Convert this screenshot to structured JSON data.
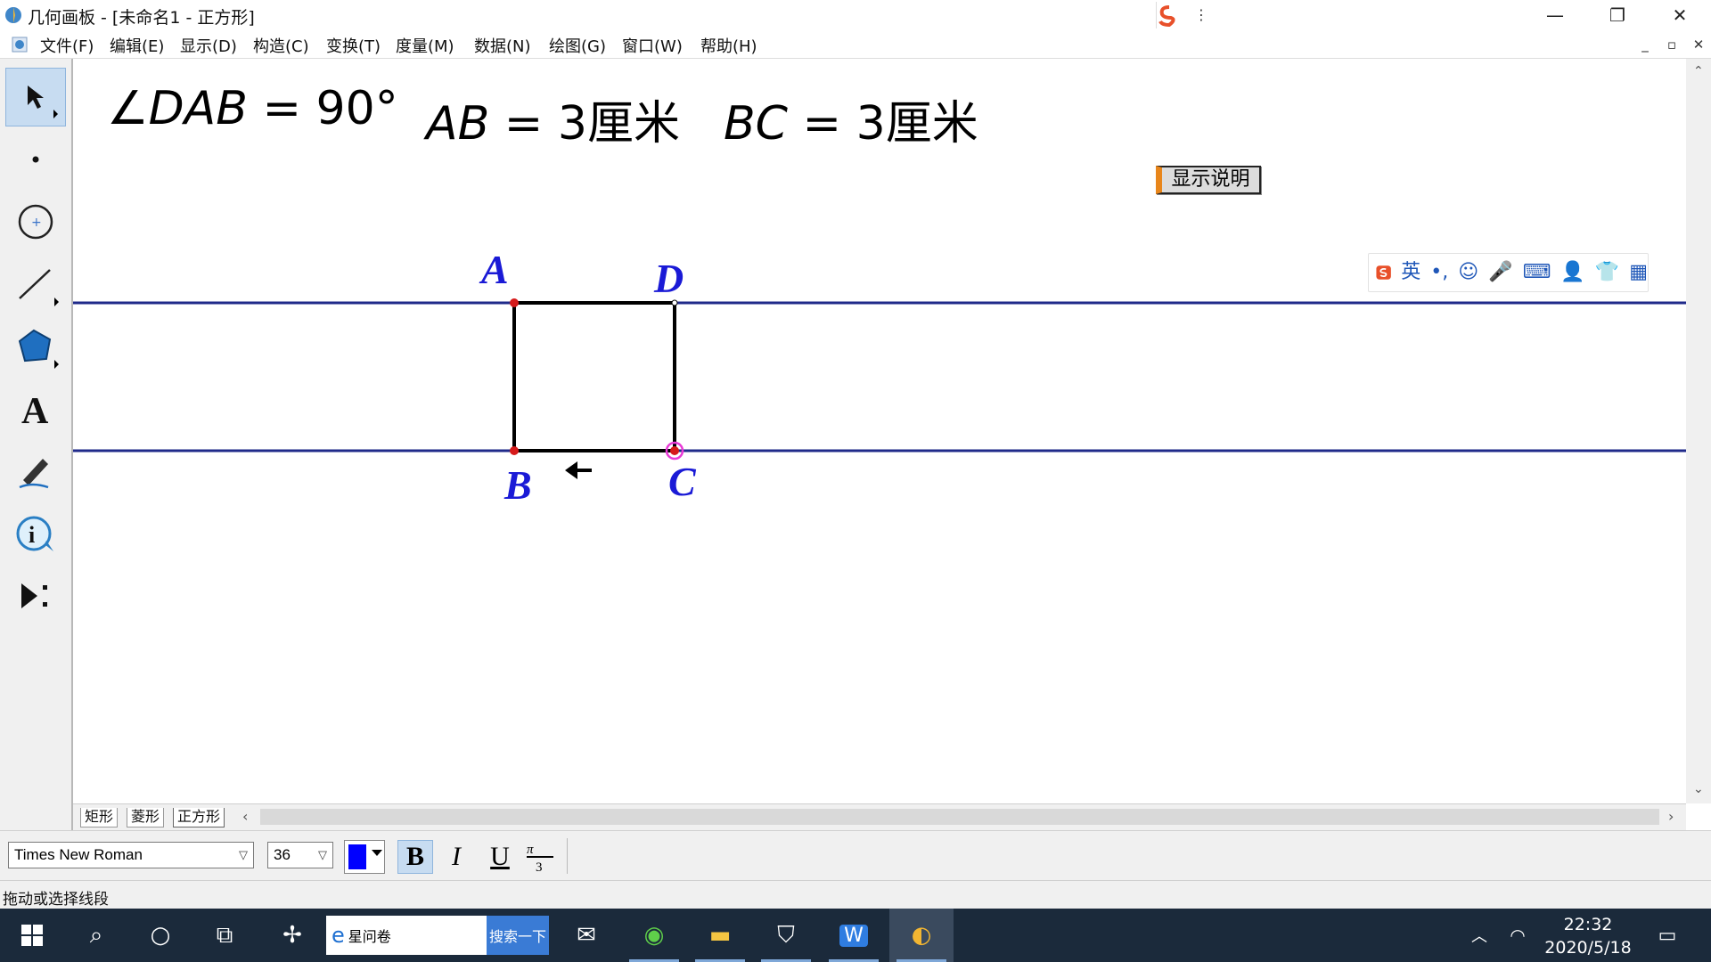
{
  "window": {
    "title": "几何画板 - [未命名1 - 正方形]",
    "buttons": {
      "minimize": "—",
      "restore": "❐",
      "close": "✕"
    }
  },
  "menu": {
    "items": [
      "文件(F)",
      "编辑(E)",
      "显示(D)",
      "构造(C)",
      "变换(T)",
      "度量(M)",
      "数据(N)",
      "绘图(G)",
      "窗口(W)",
      "帮助(H)"
    ],
    "doc_buttons": [
      "_",
      "▫",
      "✕"
    ]
  },
  "toolbox": {
    "tools": [
      "arrow-select",
      "point",
      "compass",
      "straightedge",
      "polygon",
      "text",
      "marker",
      "information",
      "custom"
    ],
    "active": "arrow-select"
  },
  "canvas": {
    "measurements": [
      {
        "prefix": "∠",
        "name": "DAB",
        "rest": " = 90°"
      },
      {
        "prefix": "",
        "name": "AB",
        "rest": " = 3厘米"
      },
      {
        "prefix": "",
        "name": "BC",
        "rest": " = 3厘米"
      }
    ],
    "show_button": "显示说明",
    "points": {
      "A": "A",
      "B": "B",
      "C": "C",
      "D": "D"
    },
    "colors": {
      "line": "#1f2a8a",
      "label": "#1a1ad6",
      "point": "#d61a1a",
      "selected": "#e83ad6"
    }
  },
  "ime": {
    "mode_label": "英",
    "icons": [
      "sogou-logo-icon",
      "punctuation-icon",
      "emoji-icon",
      "mic-icon",
      "keyboard-icon",
      "user-icon",
      "skin-icon",
      "grid-icon"
    ]
  },
  "pages": {
    "tabs": [
      "矩形",
      "菱形",
      "正方形"
    ],
    "active": "正方形"
  },
  "format": {
    "font": "Times New Roman",
    "size": "36",
    "color": "#0000ff",
    "bold": "B",
    "italic": "I",
    "underline": "U"
  },
  "status": {
    "text": "拖动或选择线段"
  },
  "taskbar": {
    "search_text": "星问卷",
    "search_button": "搜索一下",
    "time": "22:32",
    "date": "2020/5/18"
  }
}
